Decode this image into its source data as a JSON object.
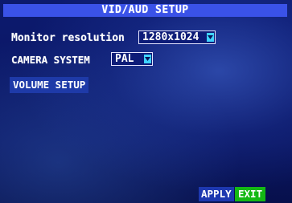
{
  "title": "VID/AUD SETUP",
  "monitor_resolution": {
    "label": "Monitor resolution",
    "value": "1280x1024"
  },
  "camera_system": {
    "label": "CAMERA SYSTEM",
    "value": "PAL"
  },
  "volume_setup": {
    "label": "VOLUME SETUP"
  },
  "footer": {
    "apply_label": "APPLY",
    "exit_label": "EXIT"
  },
  "icons": {
    "dropdown": "chevron-down-icon"
  },
  "colors": {
    "title_bar": "#3a52e8",
    "dropdown_arrow": "#3fd2ff",
    "exit_button": "#14b814",
    "background": "#0a1458"
  }
}
